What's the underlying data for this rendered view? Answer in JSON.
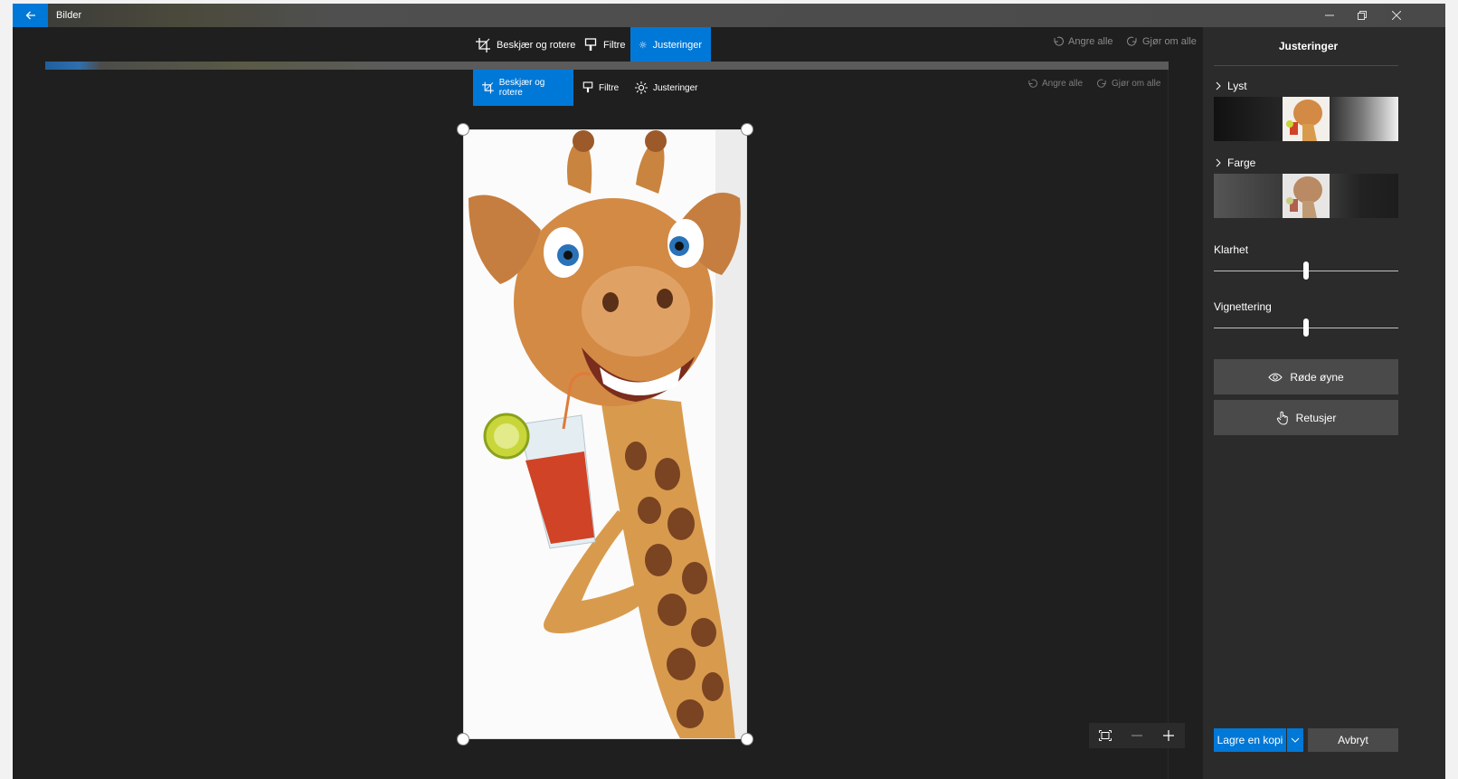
{
  "app": {
    "title": "Bilder"
  },
  "toolbar": {
    "crop_label": "Beskjær og rotere",
    "filters_label": "Filtre",
    "adjust_label": "Justeringer",
    "undo_all_label": "Angre alle",
    "redo_all_label": "Gjør om alle"
  },
  "inner_toolbar": {
    "crop_label": "Beskjær og rotere",
    "filters_label": "Filtre",
    "adjust_label": "Justeringer",
    "undo_all_label": "Angre alle",
    "redo_all_label": "Gjør om alle"
  },
  "panel": {
    "title": "Justeringer",
    "light_label": "Lyst",
    "color_label": "Farge",
    "clarity_label": "Klarhet",
    "clarity_value": 0.5,
    "vignette_label": "Vignettering",
    "vignette_value": 0.5,
    "red_eye_label": "Røde øyne",
    "retouch_label": "Retusjer",
    "save_copy_label": "Lagre en kopi",
    "cancel_label": "Avbryt"
  },
  "colors": {
    "accent": "#0078d7",
    "background": "#1f1f1f",
    "panel": "#2b2b2b"
  }
}
